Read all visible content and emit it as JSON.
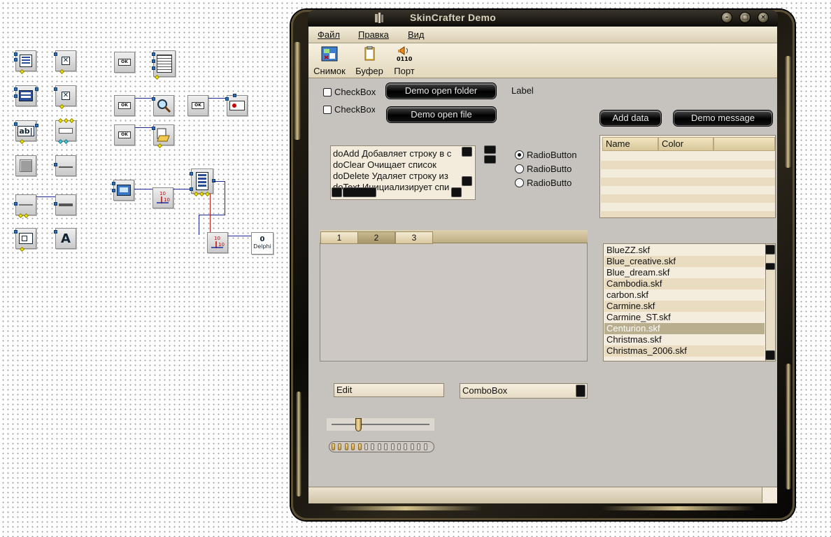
{
  "window": {
    "title": "SkinCrafter Demo",
    "buttons": {
      "minimize": "–",
      "maximize": "□",
      "close": "×"
    }
  },
  "menu": [
    "Файл",
    "Правка",
    "Вид"
  ],
  "toolbar": [
    {
      "label": "Снимок",
      "icon": "snapshot-icon"
    },
    {
      "label": "Буфер",
      "icon": "clipboard-icon"
    },
    {
      "label": "Порт",
      "icon": "port-icon",
      "caption": "0110"
    }
  ],
  "checkboxes": [
    {
      "label": "CheckBox",
      "checked": false
    },
    {
      "label": "CheckBox",
      "checked": false
    }
  ],
  "buttons": {
    "open_folder": "Demo open folder",
    "open_file": "Demo open file",
    "add_data": "Add data",
    "message": "Demo message"
  },
  "label": "Label",
  "memo": {
    "lines": [
      "doAdd Добавляет строку в с",
      "doClear Очищает список",
      "doDelete Удаляет строку из",
      "doText Инициализирует спи"
    ]
  },
  "radios": [
    {
      "label": "RadioButton",
      "selected": true
    },
    {
      "label": "RadioButto",
      "selected": false
    },
    {
      "label": "RadioButto",
      "selected": false
    }
  ],
  "grid": {
    "columns": [
      "Name",
      "Color"
    ]
  },
  "tabs": [
    "1",
    "2",
    "3"
  ],
  "active_tab": "2",
  "listbox": {
    "items": [
      "BlueZZ.skf",
      "Blue_creative.skf",
      "Blue_dream.skf",
      "Cambodia.skf",
      "carbon.skf",
      "Carmine.skf",
      "Carmine_ST.skf",
      "Centurion.skf",
      "Christmas.skf",
      "Christmas_2006.skf"
    ],
    "selected": "Centurion.skf"
  },
  "edit": {
    "value": "Edit"
  },
  "combo": {
    "value": "ComboBox"
  },
  "slider": {
    "value_fraction": 0.27
  },
  "progress": {
    "filled_segments": 5,
    "total_segments": 15
  },
  "palette": {
    "button_caption": "OK",
    "text_caption": "ab|",
    "label_caption": "A",
    "counter_label": "10",
    "delphi_caption": "Delphi",
    "delphi_digit": "0"
  },
  "colors": {
    "wire_blue": "#1b2b95",
    "wire_red": "#c02020",
    "selection": "#b9ae8e",
    "row_stripe": "#e9dcc0"
  }
}
